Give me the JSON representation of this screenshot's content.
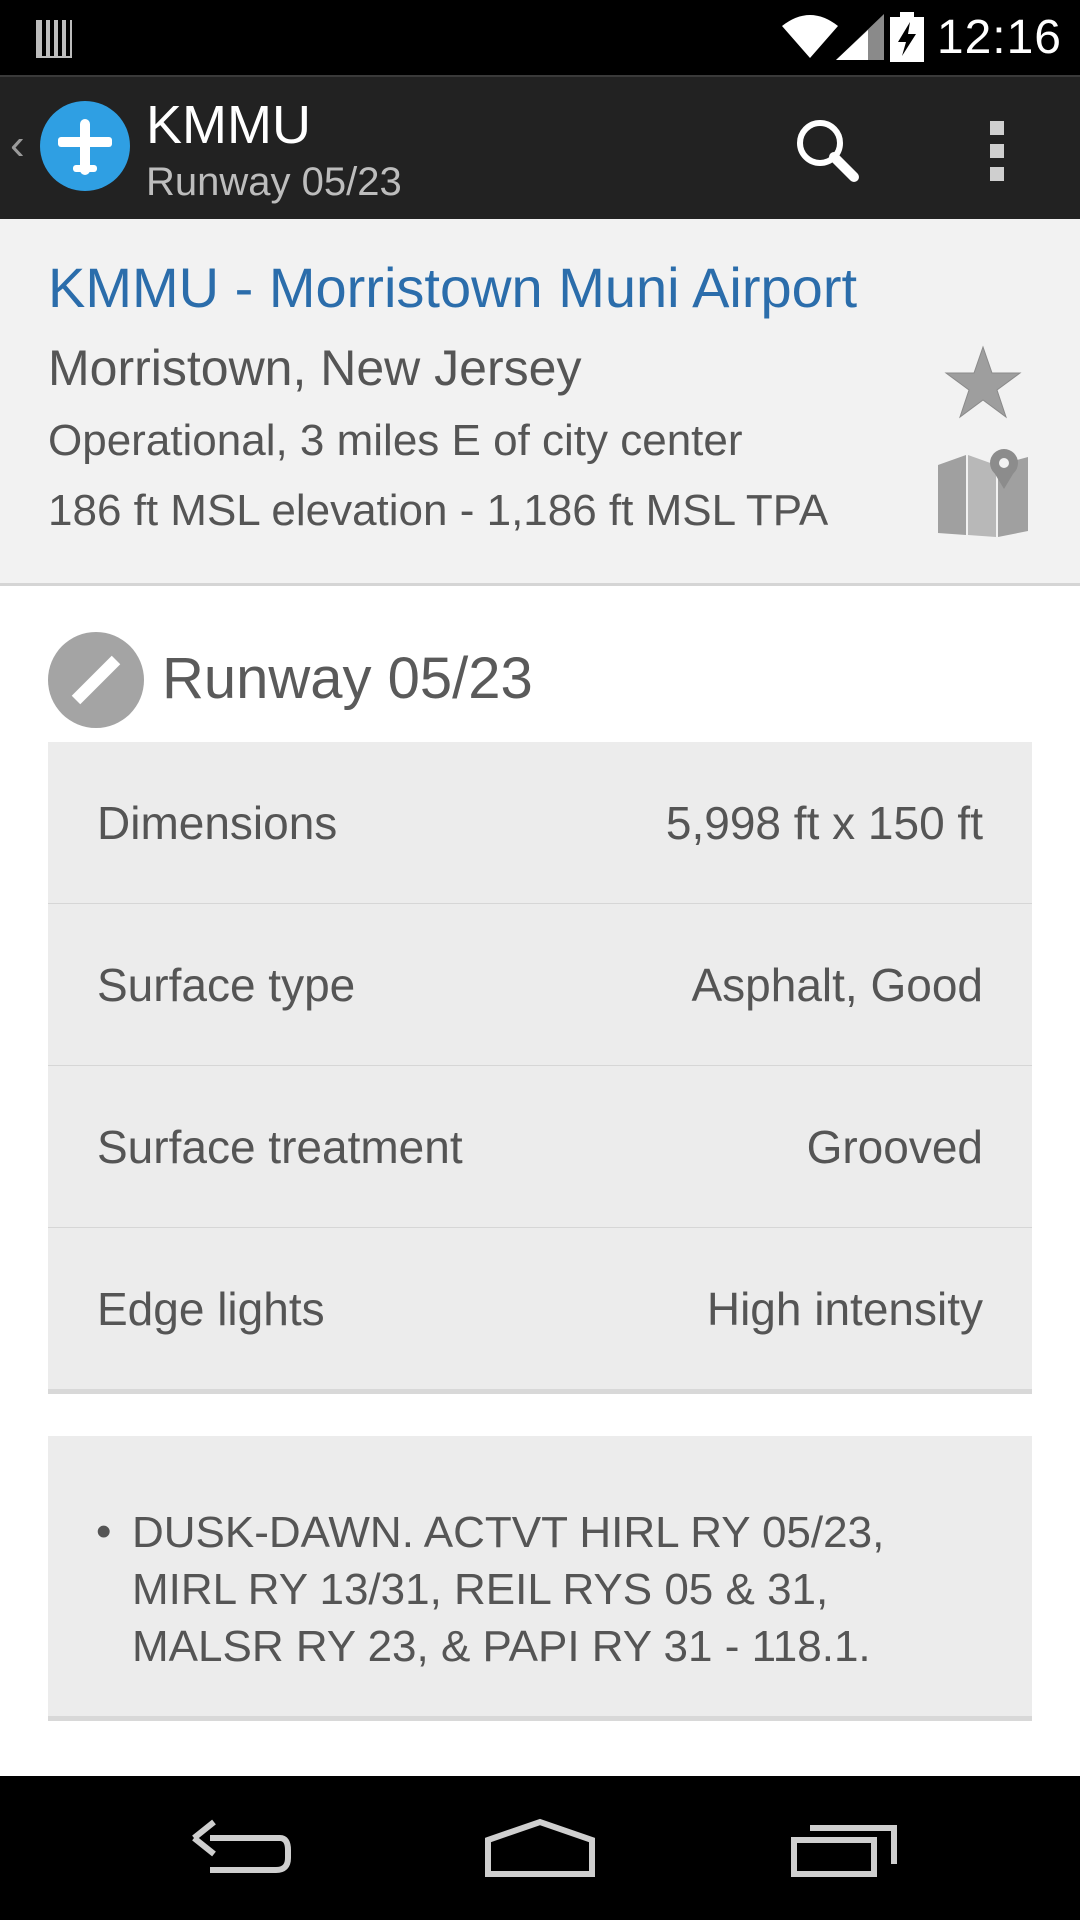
{
  "status_bar": {
    "clock": "12:16",
    "icons": [
      "notification-icon",
      "wifi-icon",
      "signal-icon",
      "battery-charging-icon"
    ]
  },
  "action_bar": {
    "title": "KMMU",
    "subtitle": "Runway 05/23",
    "icons": [
      "up-caret-icon",
      "airplane-logo-icon",
      "search-icon",
      "overflow-menu-icon"
    ]
  },
  "airport": {
    "name": "KMMU - Morristown Muni Airport",
    "city": "Morristown, New Jersey",
    "status": "Operational, 3 miles E of city center",
    "elevation": "186 ft MSL elevation - 1,186 ft MSL TPA",
    "icons": [
      "star-icon",
      "map-icon"
    ]
  },
  "runway": {
    "title": "Runway 05/23",
    "icon": "runway-icon",
    "details": [
      {
        "label": "Dimensions",
        "value": "5,998 ft x 150 ft"
      },
      {
        "label": "Surface type",
        "value": "Asphalt, Good"
      },
      {
        "label": "Surface treatment",
        "value": "Grooved"
      },
      {
        "label": "Edge lights",
        "value": "High intensity"
      }
    ],
    "remarks": [
      "DUSK-DAWN. ACTVT HIRL RY 05/23, MIRL RY 13/31, REIL RYS 05 & 31, MALSR RY 23, &  PAPI RY 31 - 118.1."
    ]
  },
  "nav_bar": {
    "icons": [
      "back-icon",
      "home-icon",
      "recents-icon"
    ]
  },
  "colors": {
    "status_bar": "#000000",
    "action_bar": "#222222",
    "logo": "#2f9fe3",
    "link": "#2b6dab",
    "card": "#ececec",
    "text": "#555555"
  }
}
